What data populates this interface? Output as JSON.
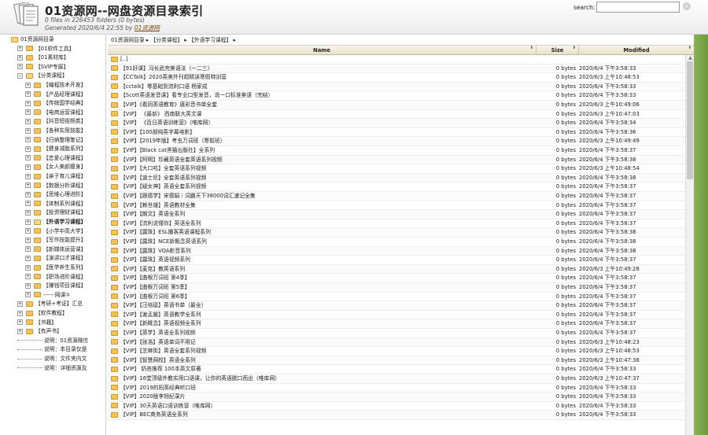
{
  "header": {
    "title": "01资源网--网盘资源目录索引",
    "stats": "0 files in 226453 folders (0 bytes)",
    "generated_prefix": "Generated 2020/6/4 22:55 by ",
    "generated_link": "01资源网",
    "search_label": "search:",
    "search_value": "",
    "search_clear": "×"
  },
  "sidebar": {
    "items": [
      {
        "label": "01资源网目录",
        "level": 0,
        "toggle": "",
        "open": true
      },
      {
        "label": "【01软件工具】",
        "level": 1,
        "toggle": "+"
      },
      {
        "label": "【01素材库】",
        "level": 1,
        "toggle": "+"
      },
      {
        "label": "【SVIP专属】",
        "level": 1,
        "toggle": "+"
      },
      {
        "label": "【分类课程】",
        "level": 1,
        "toggle": "−",
        "open": true
      },
      {
        "label": "【编程技术开发】",
        "level": 2,
        "toggle": "+"
      },
      {
        "label": "【产品经理课程】",
        "level": 2,
        "toggle": "+"
      },
      {
        "label": "【传统国学经典】",
        "level": 2,
        "toggle": "+"
      },
      {
        "label": "【电商运营课程】",
        "level": 2,
        "toggle": "+"
      },
      {
        "label": "【抖音短视频类】",
        "level": 2,
        "toggle": "+"
      },
      {
        "label": "【各种实用技能】",
        "level": 2,
        "toggle": "+"
      },
      {
        "label": "【归纳整理笔记】",
        "level": 2,
        "toggle": "+"
      },
      {
        "label": "【健身减脂系列】",
        "level": 2,
        "toggle": "+"
      },
      {
        "label": "【恋爱心理课程】",
        "level": 2,
        "toggle": "+"
      },
      {
        "label": "【女人美颜瘦身】",
        "level": 2,
        "toggle": "+"
      },
      {
        "label": "【亲子育儿课程】",
        "level": 2,
        "toggle": "+"
      },
      {
        "label": "【数据分析课程】",
        "level": 2,
        "toggle": "+"
      },
      {
        "label": "【思维心理进阶】",
        "level": 2,
        "toggle": "+"
      },
      {
        "label": "【体制系列课程】",
        "level": 2,
        "toggle": "+"
      },
      {
        "label": "【投资理财课程】",
        "level": 2,
        "toggle": "+"
      },
      {
        "label": "【外语学习课程】",
        "level": 2,
        "toggle": "+",
        "open": true
      },
      {
        "label": "【小学中高大学】",
        "level": 2,
        "toggle": "+"
      },
      {
        "label": "【写作技能提升】",
        "level": 2,
        "toggle": "+"
      },
      {
        "label": "【新媒体运营课】",
        "level": 2,
        "toggle": "+"
      },
      {
        "label": "【演讲口才课程】",
        "level": 2,
        "toggle": "+"
      },
      {
        "label": "【医学养生系列】",
        "level": 2,
        "toggle": "+"
      },
      {
        "label": "【职场进阶课程】",
        "level": 2,
        "toggle": "+"
      },
      {
        "label": "【赚钱项目课程】",
        "level": 2,
        "toggle": "+"
      },
      {
        "label": "------网课①",
        "level": 2,
        "toggle": "+"
      },
      {
        "label": "【考研+考证】汇总",
        "level": 1,
        "toggle": "+"
      },
      {
        "label": "【软件教程】",
        "level": 1,
        "toggle": "+"
      },
      {
        "label": "【书籍】",
        "level": 1,
        "toggle": "+"
      },
      {
        "label": "【有声书】",
        "level": 1,
        "toggle": "+"
      },
      {
        "label": "说明：01资源微信",
        "level": 1,
        "toggle": "",
        "dotted": true
      },
      {
        "label": "说明：本目录仅是",
        "level": 1,
        "toggle": "",
        "dotted": true
      },
      {
        "label": "说明：文件夹内文",
        "level": 1,
        "toggle": "",
        "dotted": true
      },
      {
        "label": "说明：详细资源及",
        "level": 1,
        "toggle": "",
        "dotted": true
      }
    ]
  },
  "breadcrumb": "01资源网目录 ▸ 【分类课程】 ▸ 【外语学习课程】 ▸",
  "table": {
    "columns": [
      "Name",
      "Size",
      "Modified"
    ],
    "sort_arrow": "⬍",
    "rows": [
      {
        "name": "[..]",
        "size": "",
        "modified": ""
      },
      {
        "name": "【91好课】冯长武完美语法（一二三）",
        "size": "0 bytes",
        "modified": "2020/6/4 下午3:58:33"
      },
      {
        "name": "【CCTalk】2020英美外刊超精读寒假特训营",
        "size": "0 bytes",
        "modified": "2020/6/3 上午10:48:53"
      },
      {
        "name": "【cctalk】零基础到流利口语 杨家成",
        "size": "0 bytes",
        "modified": "2020/6/4 下午3:58:33"
      },
      {
        "name": "【Scott英语发音课】看专业口型发音，说一口标准美语（完结）",
        "size": "0 bytes",
        "modified": "2020/6/4 下午3:58:33"
      },
      {
        "name": "【VIP】《看同英语教育》唐彩音书单全套",
        "size": "0 bytes",
        "modified": "2020/6/3 上午10:49:06"
      },
      {
        "name": "【VIP】 《最新》 西南联大英文课",
        "size": "0 bytes",
        "modified": "2020/6/3 上午10:47:03"
      },
      {
        "name": "【VIP】 《百日英语训练营》（唯库网）",
        "size": "0 bytes",
        "modified": "2020/6/4 下午3:58:34"
      },
      {
        "name": "【VIP】【100部纯英字幕电影】",
        "size": "0 bytes",
        "modified": "2020/6/4 下午3:58:36"
      },
      {
        "name": "【VIP】【2019年版】考虫万词班（寒假班）",
        "size": "0 bytes",
        "modified": "2020/6/3 上午10:49:49"
      },
      {
        "name": "【VIP】【Black cat黑猫出版社】全系列",
        "size": "0 bytes",
        "modified": "2020/6/4 下午3:58:37"
      },
      {
        "name": "【VIP】【阿明】珍藏英语全套英语系列视频",
        "size": "0 bytes",
        "modified": "2020/6/4 下午3:58:38"
      },
      {
        "name": "【VIP】【大口咗】全套英语系列视频",
        "size": "0 bytes",
        "modified": "2020/6/3 上午10:48:54"
      },
      {
        "name": "【VIP】【迪士尼】全套英语系列视频",
        "size": "0 bytes",
        "modified": "2020/6/4 下午3:58:38"
      },
      {
        "name": "【VIP】【疑女神】英语全套系列视频",
        "size": "0 bytes",
        "modified": "2020/6/4 下午3:58:37"
      },
      {
        "name": "【VIP】【跟德学】宋德娟｜词霸天下38000词汇速记全集",
        "size": "0 bytes",
        "modified": "2020/6/4 下午3:58:37"
      },
      {
        "name": "【VIP】【赖世雄】英语教材全集",
        "size": "0 bytes",
        "modified": "2020/6/4 下午3:58:37"
      },
      {
        "name": "【VIP】【朗文】英语全系列",
        "size": "0 bytes",
        "modified": "2020/6/4 下午3:58:37"
      },
      {
        "name": "【VIP】【流利说懂你】英语全系列",
        "size": "0 bytes",
        "modified": "2020/6/4 下午3:58:37"
      },
      {
        "name": "【VIP】【露珠】ESL播客英语课程系列",
        "size": "0 bytes",
        "modified": "2020/6/4 下午3:58:38"
      },
      {
        "name": "【VIP】【露珠】NCE新概念英语系列",
        "size": "0 bytes",
        "modified": "2020/6/4 下午3:58:38"
      },
      {
        "name": "【VIP】【露珠】VOA影音系列",
        "size": "0 bytes",
        "modified": "2020/6/4 下午3:58:38"
      },
      {
        "name": "【VIP】【露珠】英语视频系列",
        "size": "0 bytes",
        "modified": "2020/6/4 下午3:58:37"
      },
      {
        "name": "【VIP】【麦克】教英语系列",
        "size": "0 bytes",
        "modified": "2020/6/3 上午10:49:28"
      },
      {
        "name": "【VIP】【曲根万词班 第4季】",
        "size": "0 bytes",
        "modified": "2020/6/4 下午3:58:37"
      },
      {
        "name": "【VIP】【曲根万词班 第5季】",
        "size": "0 bytes",
        "modified": "2020/6/4 下午3:58:37"
      },
      {
        "name": "【VIP】【曲根万词班 第6季】",
        "size": "0 bytes",
        "modified": "2020/6/4 下午3:58:37"
      },
      {
        "name": "【VIP】【汪培珽】英语书单（最全）",
        "size": "0 bytes",
        "modified": "2020/6/4 下午3:58:37"
      },
      {
        "name": "【VIP】【谢孟媛】英语教学全系列",
        "size": "0 bytes",
        "modified": "2020/6/4 下午3:58:37"
      },
      {
        "name": "【VIP】【新概念】英语视频全系列",
        "size": "0 bytes",
        "modified": "2020/6/4 下午3:58:37"
      },
      {
        "name": "【VIP】【英学】英语全系列视频",
        "size": "0 bytes",
        "modified": "2020/6/4 下午3:58:37"
      },
      {
        "name": "【VIP】【张浩】英语单词不用记",
        "size": "0 bytes",
        "modified": "2020/6/3 上午10:48:23"
      },
      {
        "name": "【VIP】【芝麻街】英语全套系列视频",
        "size": "0 bytes",
        "modified": "2020/6/3 上午10:48:53"
      },
      {
        "name": "【VIP】【智慧网校】英语全系列",
        "size": "0 bytes",
        "modified": "2020/6/3 上午10:47:38"
      },
      {
        "name": "【VIP】 奶爸推荐 100本英文原著",
        "size": "0 bytes",
        "modified": "2020/6/4 下午3:58:33"
      },
      {
        "name": "【VIP】16堂顶级外教实用口语课，让你的英语脱口而出（唯库网）",
        "size": "0 bytes",
        "modified": "2020/6/3 上午10:47:37"
      },
      {
        "name": "【VIP】2019的阳英经典听口班",
        "size": "0 bytes",
        "modified": "2020/6/4 下午3:58:33"
      },
      {
        "name": "【VIP】2020版李旭纪录片",
        "size": "0 bytes",
        "modified": "2020/6/4 下午3:58:33"
      },
      {
        "name": "【VIP】30天英语口语训练营（唯库网）",
        "size": "0 bytes",
        "modified": "2020/6/4 下午3:58:33"
      },
      {
        "name": "【VIP】BEC商务英语全系列",
        "size": "0 bytes",
        "modified": "2020/6/4 下午3:58:33"
      }
    ]
  }
}
